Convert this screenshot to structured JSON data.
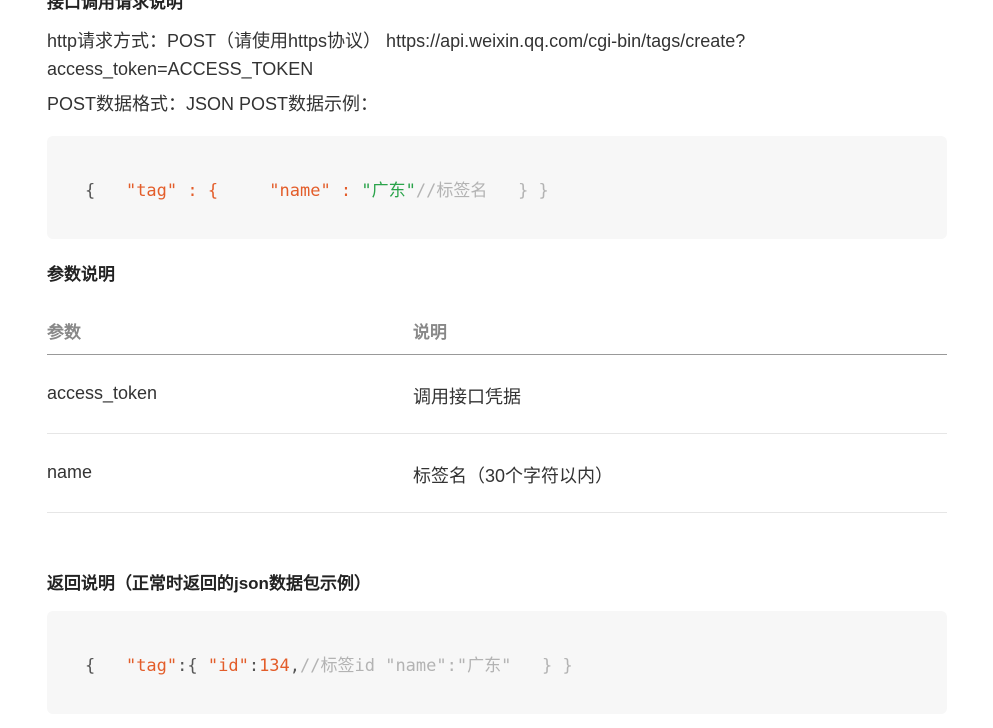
{
  "top_heading_clipped": "接口调用请求说明",
  "request": {
    "line1": "http请求方式：POST（请使用https协议） https://api.weixin.qq.com/cgi-bin/tags/create?",
    "line2": "access_token=ACCESS_TOKEN",
    "format": "POST数据格式：JSON POST数据示例："
  },
  "code1": {
    "open": "{   ",
    "tag_key": "\"tag\"",
    "colon1": " : {     ",
    "name_key": "\"name\"",
    "colon2": " : ",
    "name_val": "\"广东\"",
    "comment": "//标签名",
    "close": "   } }"
  },
  "params": {
    "title": "参数说明",
    "headers": [
      "参数",
      "说明"
    ],
    "rows": [
      [
        "access_token",
        "调用接口凭据"
      ],
      [
        "name",
        "标签名（30个字符以内）"
      ]
    ]
  },
  "return_section": {
    "title": "返回说明（正常时返回的json数据包示例）"
  },
  "code2": {
    "open": "{   ",
    "tag_key": "\"tag\"",
    "colon1": ":{ ",
    "id_key": "\"id\"",
    "colon2": ":",
    "id_val": "134",
    "comma": ",",
    "comment": "//标签id \"name\":\"广东\"",
    "close": "   } }"
  }
}
